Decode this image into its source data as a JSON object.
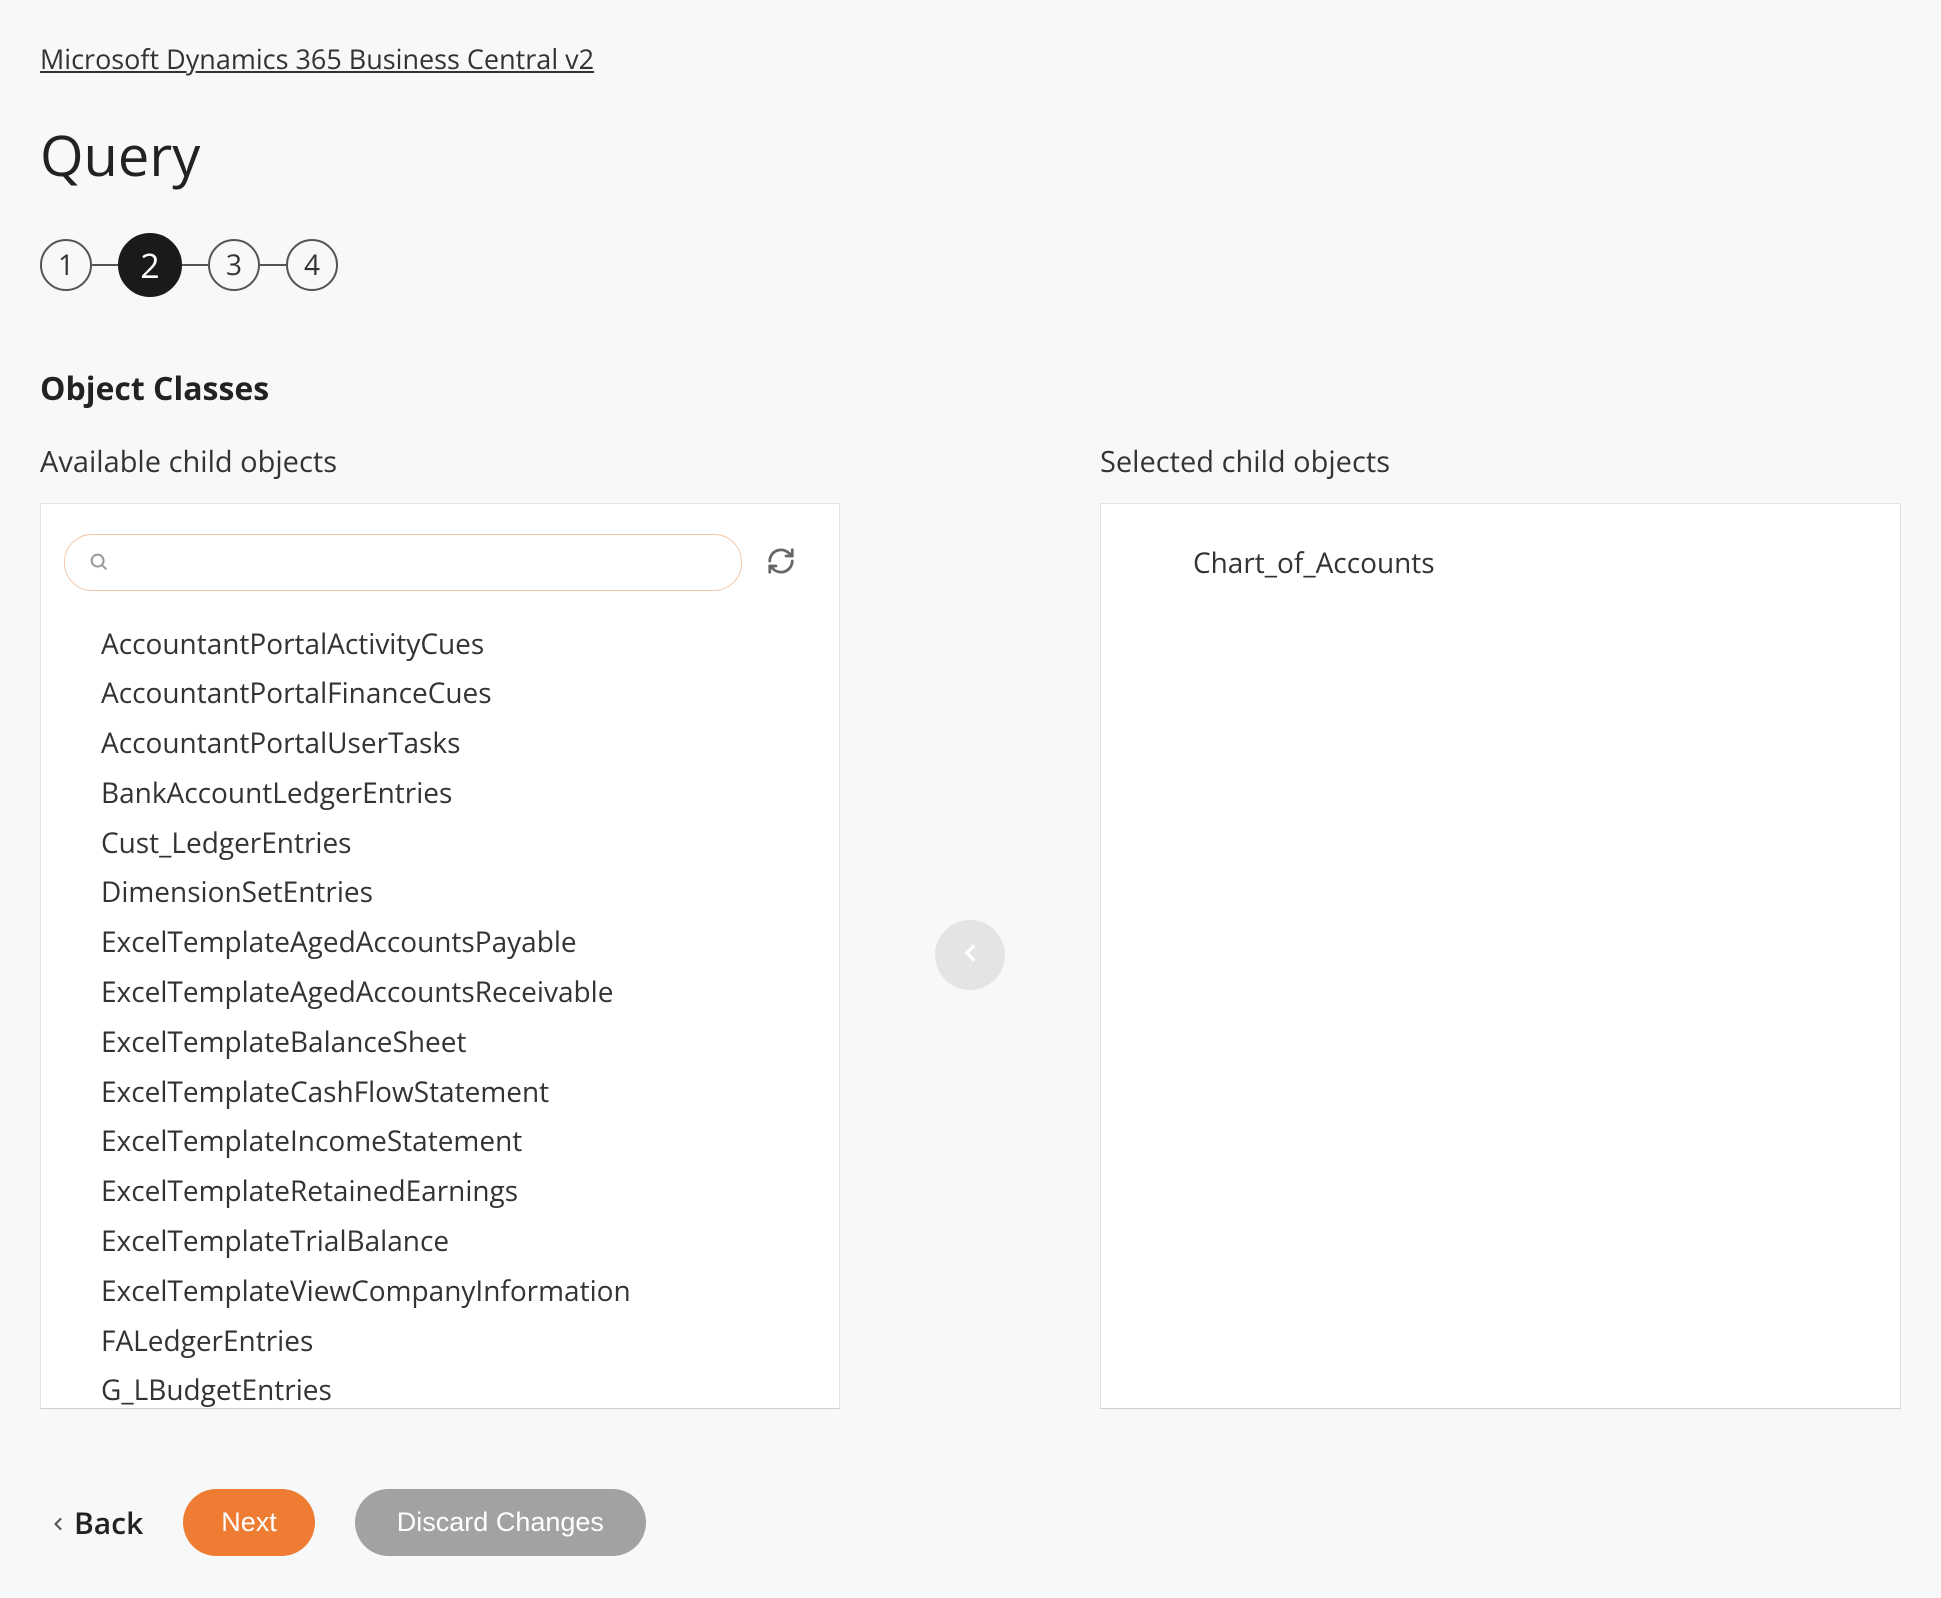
{
  "breadcrumb": "Microsoft Dynamics 365 Business Central v2",
  "page_title": "Query",
  "stepper": {
    "steps": [
      "1",
      "2",
      "3",
      "4"
    ],
    "active_index": 1
  },
  "section_title": "Object Classes",
  "available": {
    "label": "Available child objects",
    "search_value": "",
    "search_placeholder": "",
    "items": [
      "AccountantPortalActivityCues",
      "AccountantPortalFinanceCues",
      "AccountantPortalUserTasks",
      "BankAccountLedgerEntries",
      "Cust_LedgerEntries",
      "DimensionSetEntries",
      "ExcelTemplateAgedAccountsPayable",
      "ExcelTemplateAgedAccountsReceivable",
      "ExcelTemplateBalanceSheet",
      "ExcelTemplateCashFlowStatement",
      "ExcelTemplateIncomeStatement",
      "ExcelTemplateRetainedEarnings",
      "ExcelTemplateTrialBalance",
      "ExcelTemplateViewCompanyInformation",
      "FALedgerEntries",
      "G_LBudgetEntries"
    ]
  },
  "selected": {
    "label": "Selected child objects",
    "items": [
      "Chart_of_Accounts"
    ]
  },
  "actions": {
    "back": "Back",
    "next": "Next",
    "discard": "Discard Changes"
  }
}
